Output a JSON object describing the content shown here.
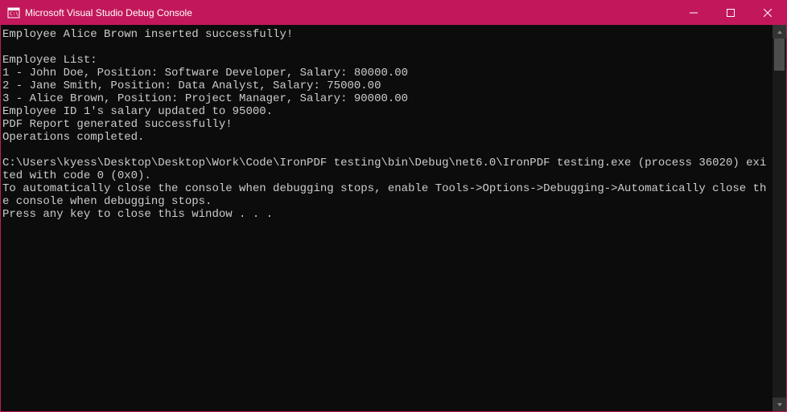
{
  "window": {
    "title": "Microsoft Visual Studio Debug Console"
  },
  "console": {
    "lines": [
      "Employee Alice Brown inserted successfully!",
      "",
      "Employee List:",
      "1 - John Doe, Position: Software Developer, Salary: 80000.00",
      "2 - Jane Smith, Position: Data Analyst, Salary: 75000.00",
      "3 - Alice Brown, Position: Project Manager, Salary: 90000.00",
      "Employee ID 1's salary updated to 95000.",
      "PDF Report generated successfully!",
      "Operations completed.",
      "",
      "C:\\Users\\kyess\\Desktop\\Desktop\\Work\\Code\\IronPDF testing\\bin\\Debug\\net6.0\\IronPDF testing.exe (process 36020) exited with code 0 (0x0).",
      "To automatically close the console when debugging stops, enable Tools->Options->Debugging->Automatically close the console when debugging stops.",
      "Press any key to close this window . . ."
    ]
  }
}
